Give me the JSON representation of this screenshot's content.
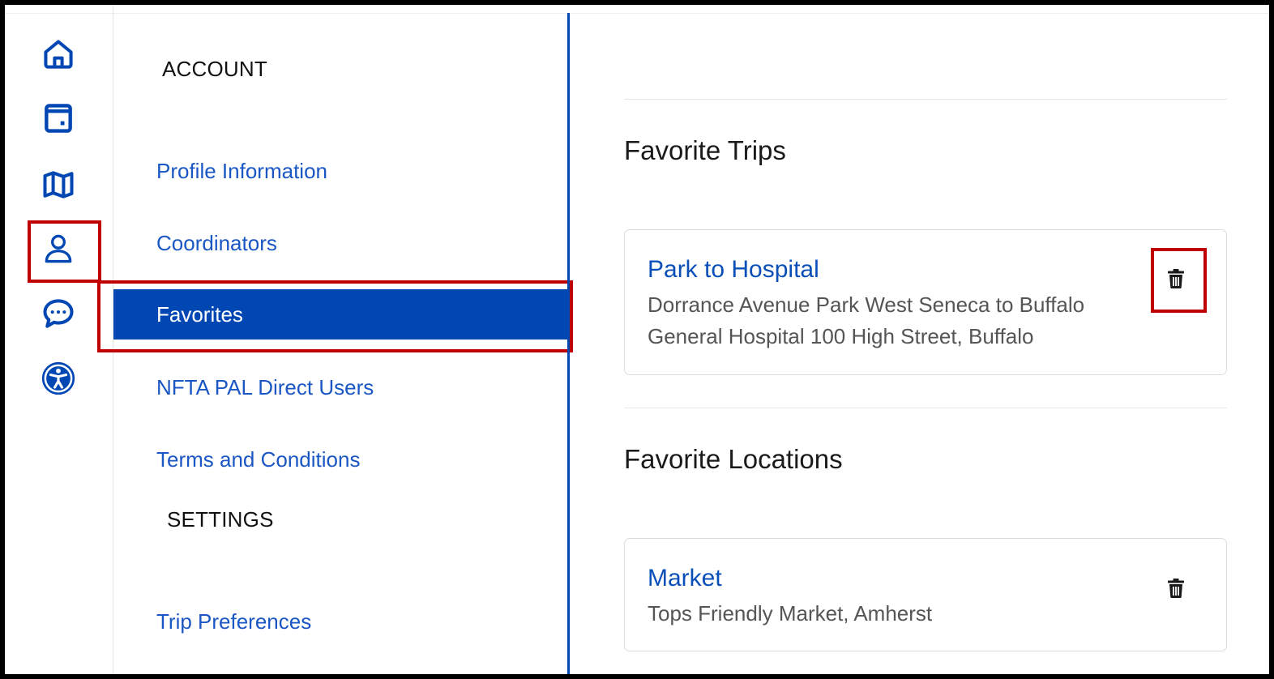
{
  "rail": {
    "icons": [
      "home-icon",
      "calendar-icon",
      "map-icon",
      "person-icon",
      "chat-icon",
      "accessibility-icon"
    ],
    "accent": "#0047b3",
    "highlight": "#c00000"
  },
  "menu": {
    "account_heading": "ACCOUNT",
    "items": [
      {
        "label": "Profile Information"
      },
      {
        "label": "Coordinators"
      },
      {
        "label": "Favorites",
        "active": true
      },
      {
        "label": "NFTA PAL Direct Users"
      },
      {
        "label": "Terms and Conditions"
      }
    ],
    "settings_heading": "SETTINGS",
    "settings_items": [
      {
        "label": "Trip Preferences"
      }
    ]
  },
  "main": {
    "trips_heading": "Favorite Trips",
    "trips": [
      {
        "title": "Park to Hospital",
        "description": "Dorrance Avenue Park West Seneca to Buffalo General Hospital 100 High Street, Buffalo"
      }
    ],
    "locations_heading": "Favorite Locations",
    "locations": [
      {
        "title": "Market",
        "description": "Tops Friendly Market, Amherst"
      }
    ]
  }
}
